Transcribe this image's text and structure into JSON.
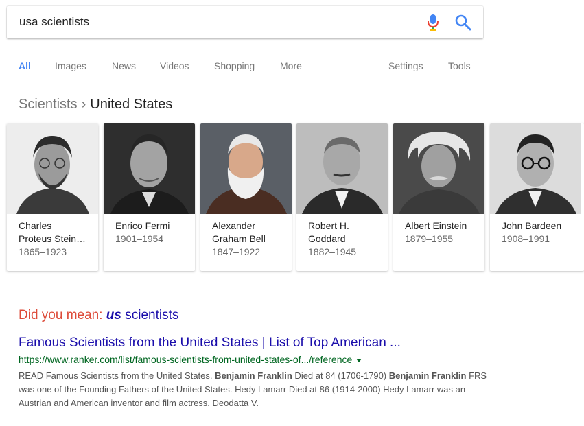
{
  "search": {
    "query": "usa scientists"
  },
  "tabs": [
    {
      "label": "All"
    },
    {
      "label": "Images"
    },
    {
      "label": "News"
    },
    {
      "label": "Videos"
    },
    {
      "label": "Shopping"
    },
    {
      "label": "More"
    },
    {
      "label": "Settings"
    },
    {
      "label": "Tools"
    }
  ],
  "breadcrumb": {
    "parent": "Scientists",
    "separator": "›",
    "current": "United States"
  },
  "scientists": [
    {
      "name_line1": "Charles",
      "name_line2": "Proteus Stein…",
      "years": "1865–1923"
    },
    {
      "name_line1": "Enrico Fermi",
      "name_line2": "",
      "years": "1901–1954"
    },
    {
      "name_line1": "Alexander",
      "name_line2": "Graham Bell",
      "years": "1847–1922"
    },
    {
      "name_line1": "Robert H.",
      "name_line2": "Goddard",
      "years": "1882–1945"
    },
    {
      "name_line1": "Albert Einstein",
      "name_line2": "",
      "years": "1879–1955"
    },
    {
      "name_line1": "John Bardeen",
      "name_line2": "",
      "years": "1908–1991"
    }
  ],
  "did_you_mean": {
    "label": "Did you mean:",
    "correction_bold": "us",
    "correction_rest": " scientists"
  },
  "result": {
    "title": "Famous Scientists from the United States | List of Top American ...",
    "url": "https://www.ranker.com/list/famous-scientists-from-united-states-of.../reference",
    "snippet": {
      "part1": "READ Famous Scientists from the United States. ",
      "bold1": "Benjamin Franklin",
      "part2": " Died at 84 (1706-1790) ",
      "bold2": "Benjamin Franklin",
      "part3": " FRS was one of the Founding Fathers of the United States. Hedy Lamarr Died at 86 (1914-2000) Hedy Lamarr was an Austrian and American inventor and film actress. Deodatta V."
    }
  },
  "colors": {
    "accent_blue": "#4285f4",
    "link": "#1a0dab",
    "url_green": "#006621",
    "did_you_mean_red": "#dd4b39"
  },
  "icons": {
    "mic": "microphone-icon",
    "search": "search-icon",
    "url_menu": "dropdown-arrow-icon"
  }
}
